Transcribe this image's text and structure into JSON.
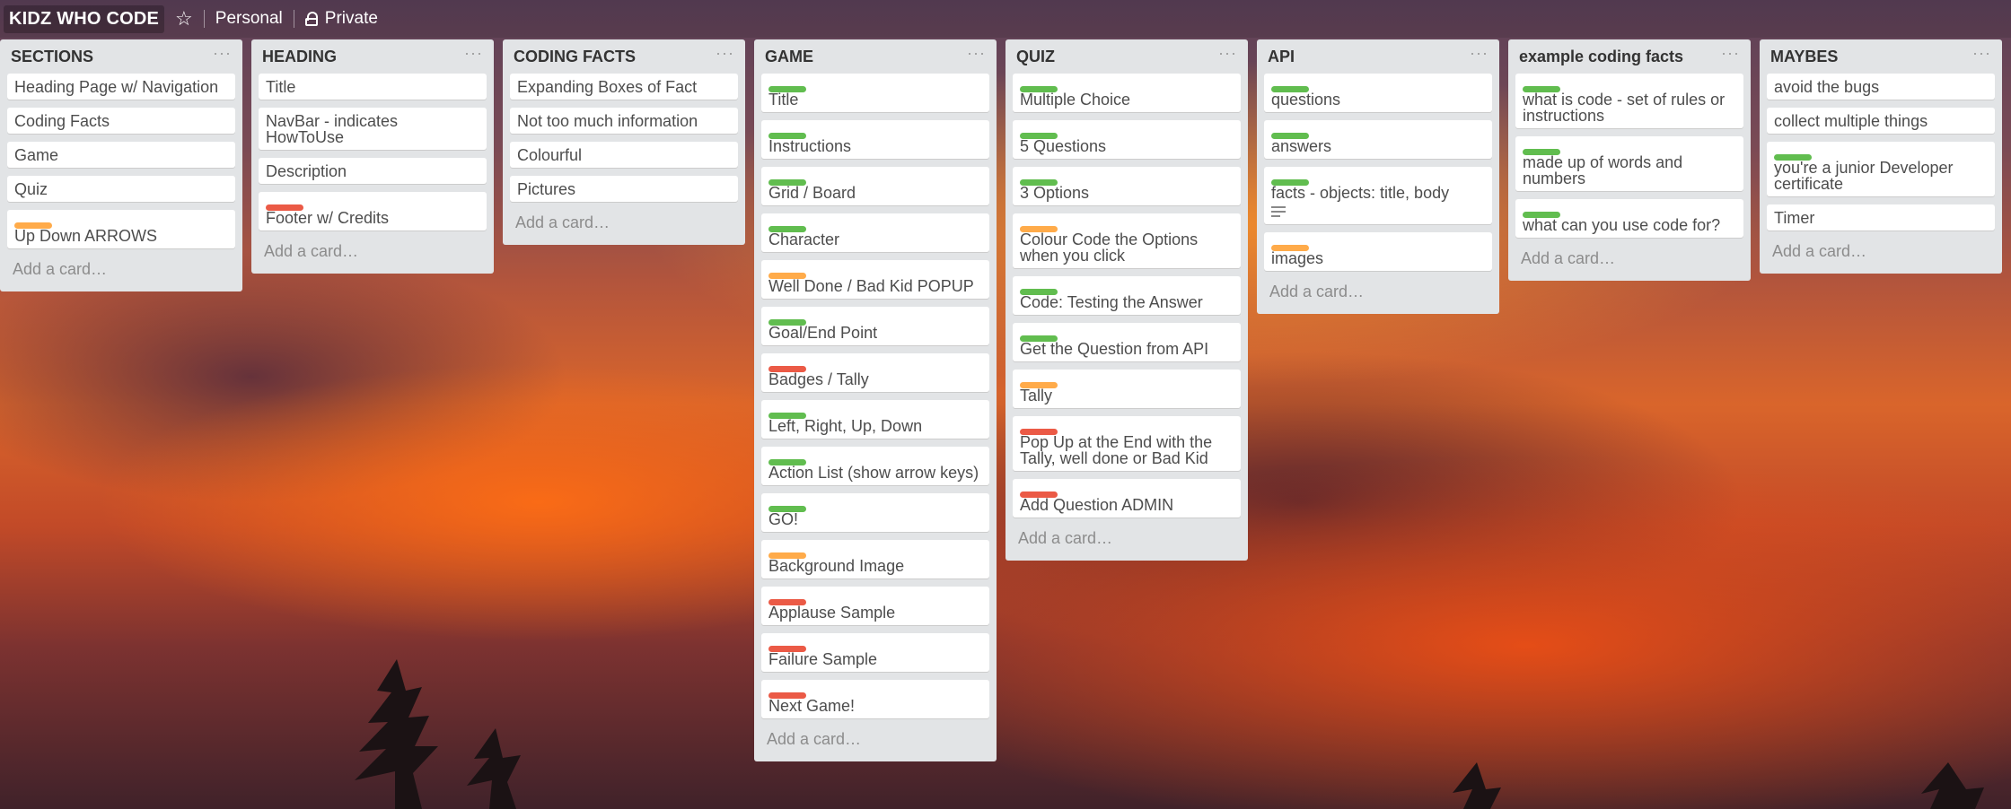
{
  "header": {
    "title": "KIDZ WHO CODE",
    "personal": "Personal",
    "visibility": "Private"
  },
  "add_card_label": "Add a card…",
  "list_menu_glyph": "···",
  "lists": [
    {
      "title": "SECTIONS",
      "cards": [
        {
          "text": "Heading Page w/ Navigation",
          "labels": []
        },
        {
          "text": "Coding Facts",
          "labels": []
        },
        {
          "text": "Game",
          "labels": []
        },
        {
          "text": "Quiz",
          "labels": []
        },
        {
          "text": "Up Down ARROWS",
          "labels": [
            "orange"
          ]
        }
      ]
    },
    {
      "title": "HEADING",
      "cards": [
        {
          "text": "Title",
          "labels": []
        },
        {
          "text": "NavBar - indicates HowToUse",
          "labels": []
        },
        {
          "text": "Description",
          "labels": []
        },
        {
          "text": "Footer w/ Credits",
          "labels": [
            "red"
          ]
        }
      ]
    },
    {
      "title": "CODING FACTS",
      "cards": [
        {
          "text": "Expanding Boxes of Fact",
          "labels": []
        },
        {
          "text": "Not too much information",
          "labels": []
        },
        {
          "text": "Colourful",
          "labels": []
        },
        {
          "text": "Pictures",
          "labels": []
        }
      ]
    },
    {
      "title": "GAME",
      "cards": [
        {
          "text": "Title",
          "labels": [
            "green"
          ]
        },
        {
          "text": "Instructions",
          "labels": [
            "green"
          ]
        },
        {
          "text": "Grid / Board",
          "labels": [
            "green"
          ]
        },
        {
          "text": "Character",
          "labels": [
            "green"
          ]
        },
        {
          "text": "Well Done / Bad Kid POPUP",
          "labels": [
            "orange"
          ]
        },
        {
          "text": "Goal/End Point",
          "labels": [
            "green"
          ]
        },
        {
          "text": "Badges / Tally",
          "labels": [
            "red"
          ]
        },
        {
          "text": "Left, Right, Up, Down",
          "labels": [
            "green"
          ]
        },
        {
          "text": "Action List (show arrow keys)",
          "labels": [
            "green"
          ]
        },
        {
          "text": "GO!",
          "labels": [
            "green"
          ]
        },
        {
          "text": "Background Image",
          "labels": [
            "orange"
          ]
        },
        {
          "text": "Applause Sample",
          "labels": [
            "red"
          ]
        },
        {
          "text": "Failure Sample",
          "labels": [
            "red"
          ]
        },
        {
          "text": "Next Game!",
          "labels": [
            "red"
          ]
        }
      ]
    },
    {
      "title": "QUIZ",
      "cards": [
        {
          "text": "Multiple Choice",
          "labels": [
            "green"
          ]
        },
        {
          "text": "5 Questions",
          "labels": [
            "green"
          ]
        },
        {
          "text": "3 Options",
          "labels": [
            "green"
          ]
        },
        {
          "text": "Colour Code the Options when you click",
          "labels": [
            "orange"
          ]
        },
        {
          "text": "Code: Testing the Answer",
          "labels": [
            "green"
          ]
        },
        {
          "text": "Get the Question from API",
          "labels": [
            "green"
          ]
        },
        {
          "text": "Tally",
          "labels": [
            "orange"
          ]
        },
        {
          "text": "Pop Up at the End with the Tally, well done or Bad Kid",
          "labels": [
            "red"
          ]
        },
        {
          "text": "Add Question ADMIN",
          "labels": [
            "red"
          ]
        }
      ]
    },
    {
      "title": "API",
      "cards": [
        {
          "text": "questions",
          "labels": [
            "green"
          ]
        },
        {
          "text": "answers",
          "labels": [
            "green"
          ]
        },
        {
          "text": "facts - objects: title, body",
          "labels": [
            "green"
          ],
          "has_description": true
        },
        {
          "text": "images",
          "labels": [
            "orange"
          ]
        }
      ]
    },
    {
      "title": "example coding facts",
      "cards": [
        {
          "text": "what is code - set of rules or instructions",
          "labels": [
            "green"
          ]
        },
        {
          "text": "made up of words and numbers",
          "labels": [
            "green"
          ]
        },
        {
          "text": "what can you use code for?",
          "labels": [
            "green"
          ]
        }
      ]
    },
    {
      "title": "MAYBES",
      "cards": [
        {
          "text": "avoid the bugs",
          "labels": []
        },
        {
          "text": "collect multiple things",
          "labels": []
        },
        {
          "text": "you're a junior Developer certificate",
          "labels": [
            "green"
          ]
        },
        {
          "text": "Timer",
          "labels": []
        }
      ]
    }
  ],
  "colors": {
    "green": "#61bd4f",
    "orange": "#ffab4a",
    "red": "#eb5a46",
    "list_bg": "#e2e4e6"
  }
}
